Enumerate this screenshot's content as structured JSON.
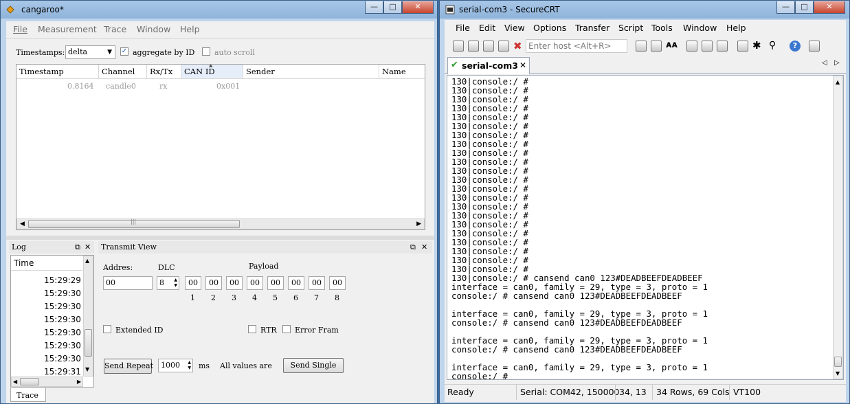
{
  "cangaroo": {
    "title": "cangaroo*",
    "menu": [
      "File",
      "Measurement",
      "Trace",
      "Window",
      "Help"
    ],
    "timestamps_label": "Timestamps:",
    "timestamps_value": "delta",
    "aggregate_label": "aggregate by ID",
    "aggregate_checked": true,
    "autoscroll_label": "auto scroll",
    "autoscroll_checked": false,
    "columns": [
      "Timestamp",
      "Channel",
      "Rx/Tx",
      "CAN ID",
      "Sender",
      "Name"
    ],
    "rows": [
      {
        "timestamp": "0.8164",
        "channel": "candle0",
        "rxtx": "rx",
        "can_id": "0x001",
        "sender": "",
        "name": ""
      }
    ],
    "log": {
      "title": "Log",
      "column": "Time",
      "times": [
        "15:29:29",
        "15:29:30",
        "15:29:30",
        "15:29:30",
        "15:29:30",
        "15:29:30",
        "15:29:30",
        "15:29:31"
      ]
    },
    "transmit": {
      "title": "Transmit View",
      "address_label": "Addres:",
      "address_value": "00",
      "dlc_label": "DLC",
      "dlc_value": "8",
      "payload_label": "Payload",
      "payload": [
        "00",
        "00",
        "00",
        "00",
        "00",
        "00",
        "00",
        "00"
      ],
      "payload_indices": [
        "1",
        "2",
        "3",
        "4",
        "5",
        "6",
        "7",
        "8"
      ],
      "extended_label": "Extended ID",
      "rtr_label": "RTR",
      "error_label": "Error Fram",
      "send_repeat_label": "Send Repeat",
      "interval_value": "1000",
      "interval_unit": "ms",
      "all_values_label": "All values are",
      "send_single_label": "Send Single"
    },
    "bottom_tab": "Trace"
  },
  "securecrt": {
    "title": "serial-com3 - SecureCRT",
    "menu": [
      "File",
      "Edit",
      "View",
      "Options",
      "Transfer",
      "Script",
      "Tools",
      "Window",
      "Help"
    ],
    "host_placeholder": "Enter host <Alt+R>",
    "tab_label": "serial-com3",
    "terminal_lines": [
      "130|console:/ #",
      "130|console:/ #",
      "130|console:/ #",
      "130|console:/ #",
      "130|console:/ #",
      "130|console:/ #",
      "130|console:/ #",
      "130|console:/ #",
      "130|console:/ #",
      "130|console:/ #",
      "130|console:/ #",
      "130|console:/ #",
      "130|console:/ #",
      "130|console:/ #",
      "130|console:/ #",
      "130|console:/ #",
      "130|console:/ #",
      "130|console:/ #",
      "130|console:/ #",
      "130|console:/ #",
      "130|console:/ #",
      "130|console:/ #",
      "130|console:/ # cansend can0 123#DEADBEEFDEADBEEF",
      "interface = can0, family = 29, type = 3, proto = 1",
      "console:/ # cansend can0 123#DEADBEEFDEADBEEF",
      "",
      "interface = can0, family = 29, type = 3, proto = 1",
      "console:/ # cansend can0 123#DEADBEEFDEADBEEF",
      "",
      "interface = can0, family = 29, type = 3, proto = 1",
      "console:/ # cansend can0 123#DEADBEEFDEADBEEF",
      "",
      "interface = can0, family = 29, type = 3, proto = 1",
      "console:/ #"
    ],
    "status": {
      "ready": "Ready",
      "port": "Serial: COM42, 150000",
      "cursor": "34,  13",
      "size": "34 Rows, 69 Cols",
      "emulation": "VT100"
    }
  },
  "colors": {
    "window_frame": "#bfd5ec",
    "close_button": "#c7452f",
    "tab_check": "#2e9b2e"
  },
  "icons": [
    "cangaroo-logo-icon",
    "securecrt-logo-icon",
    "minimize-icon",
    "maximize-icon",
    "close-icon",
    "checkmark-icon",
    "chevron-left-icon",
    "chevron-right-icon"
  ]
}
